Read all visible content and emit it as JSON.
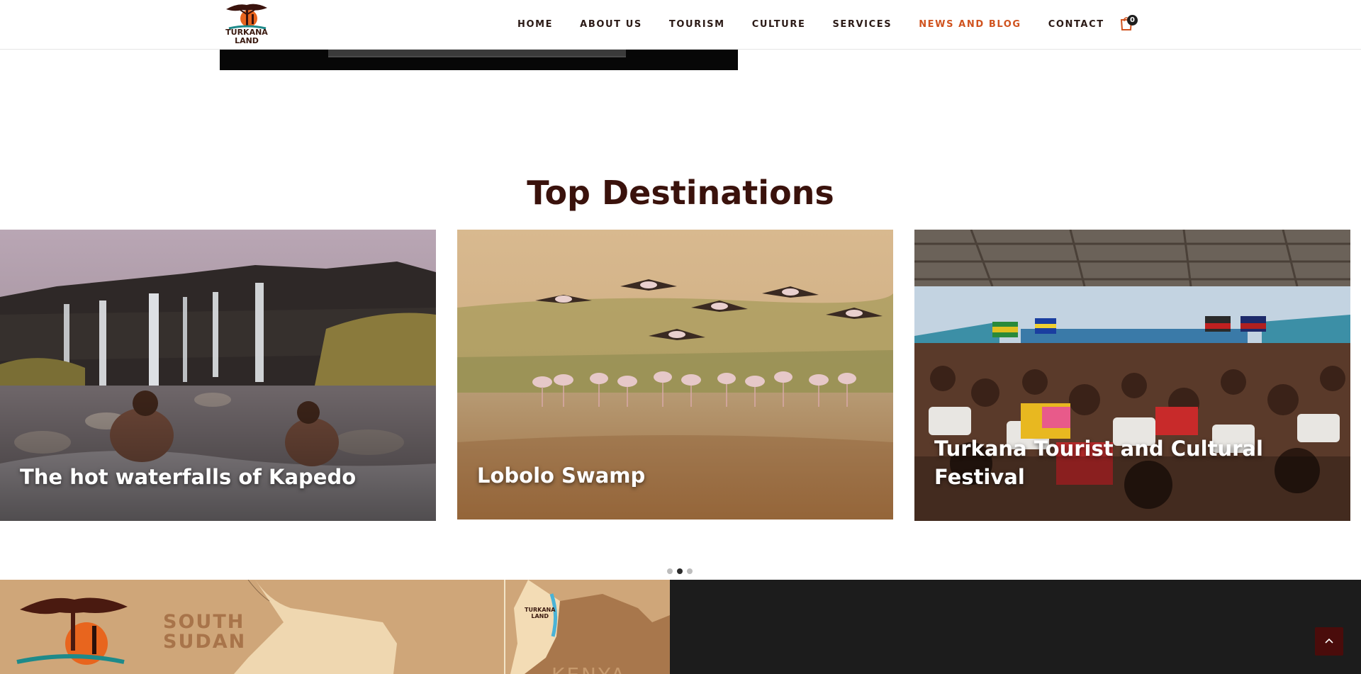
{
  "header": {
    "logo_text_line1": "TURKANA",
    "logo_text_line2": "LAND",
    "nav": [
      {
        "label": "HOME"
      },
      {
        "label": "ABOUT US"
      },
      {
        "label": "TOURISM"
      },
      {
        "label": "CULTURE"
      },
      {
        "label": "SERVICES"
      },
      {
        "label": "NEWS AND BLOG",
        "active": true
      },
      {
        "label": "CONTACT"
      }
    ],
    "cart_count": "0",
    "cart_icon": "shopping-bag-icon"
  },
  "section": {
    "title": "Top Destinations"
  },
  "destinations": [
    {
      "title": "The hot waterfalls of Kapedo"
    },
    {
      "title": "Lobolo Swamp"
    },
    {
      "title": "Turkana Tourist and Cultural Festival"
    }
  ],
  "carousel": {
    "dot_count": 3,
    "active_index": 1
  },
  "map": {
    "label_south": "SOUTH",
    "label_sudan": "SUDAN",
    "label_kenya": "KENYA",
    "small_logo_line1": "TURKANA",
    "small_logo_line2": "LAND"
  },
  "colors": {
    "accent": "#d0531f",
    "title": "#3a120c",
    "scroll_top_button": "#4a0c0b",
    "footer_dark": "#1c1c1c",
    "map_background": "#cfa679"
  }
}
